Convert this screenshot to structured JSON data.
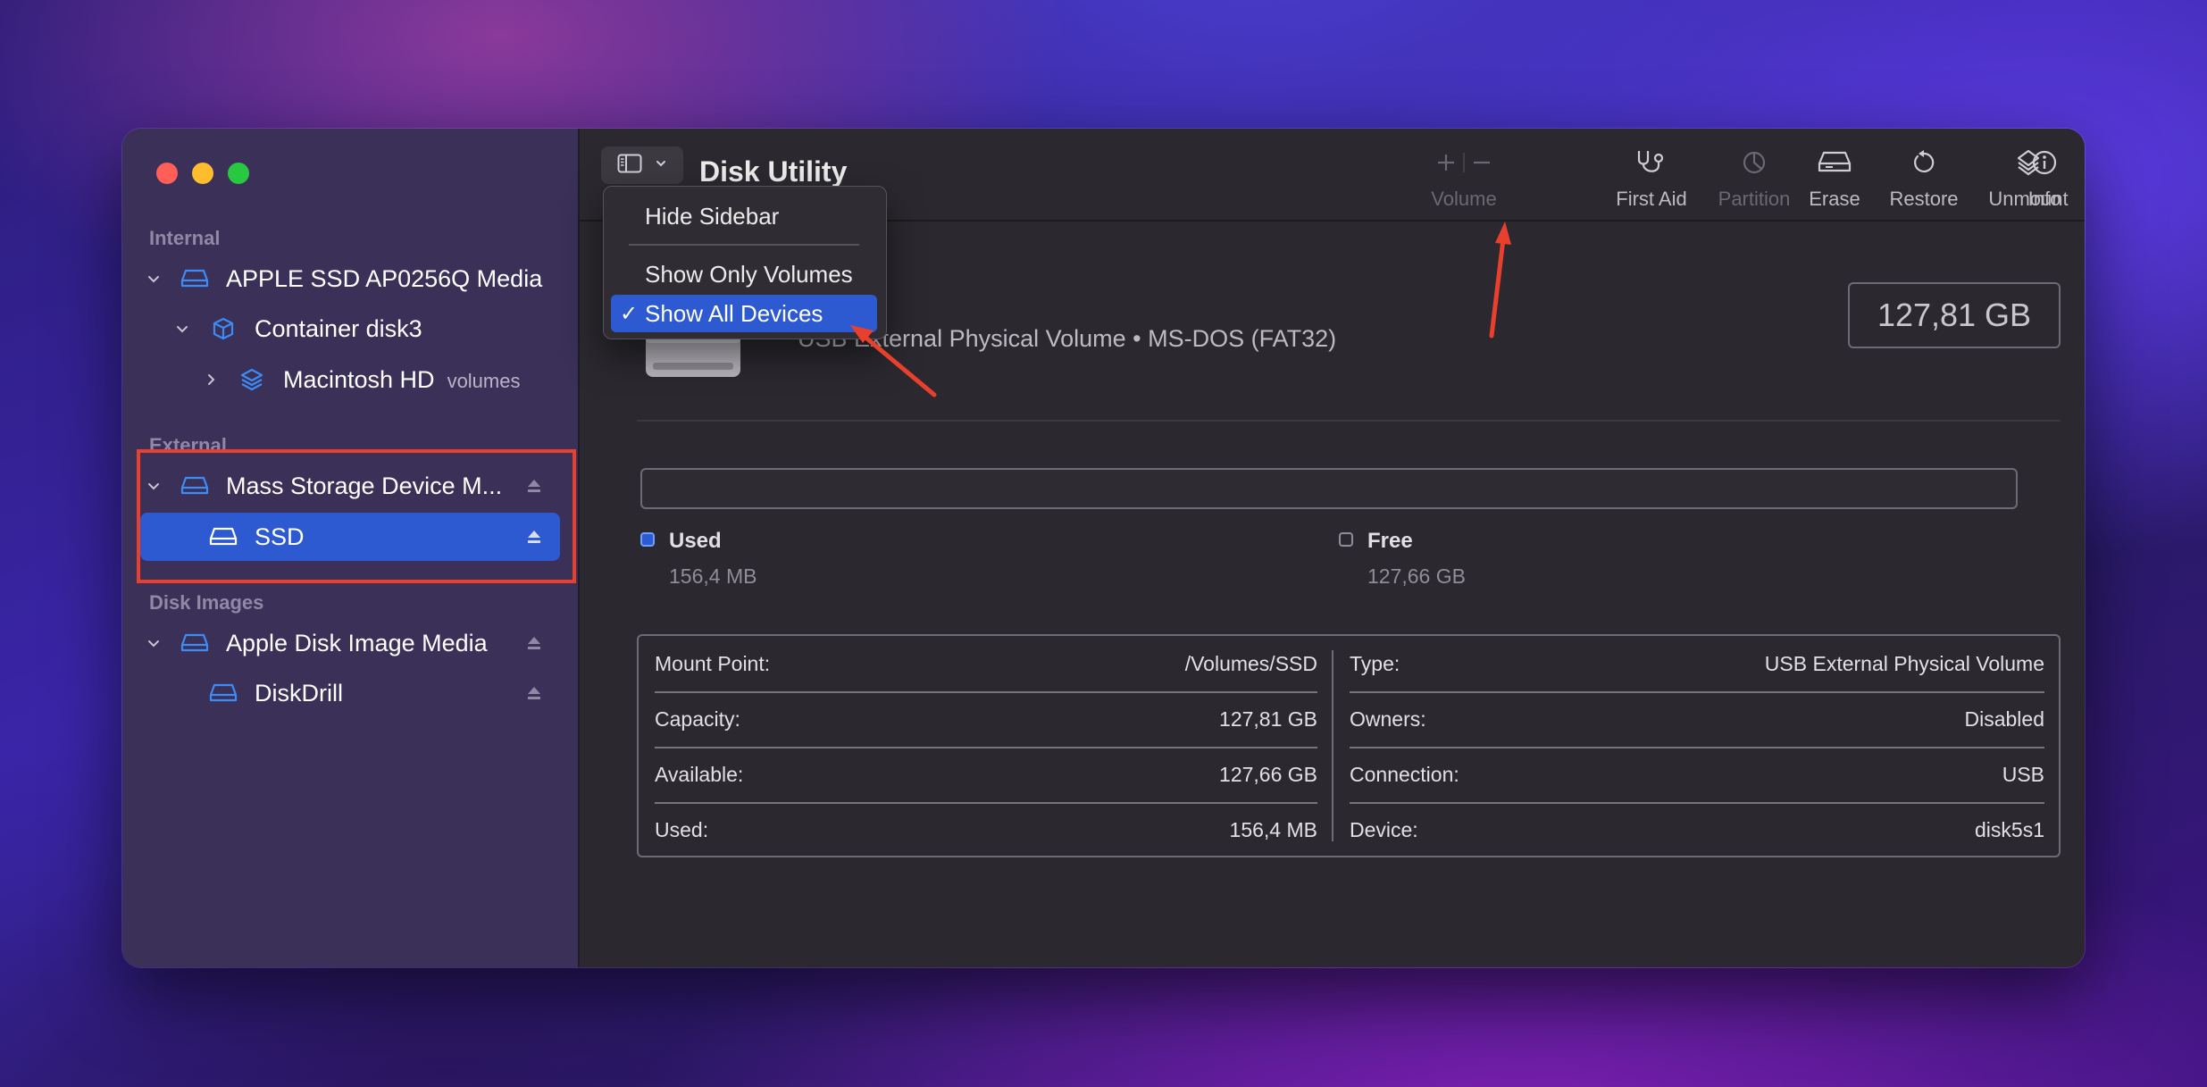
{
  "app": {
    "title": "Disk Utility"
  },
  "sidebar": {
    "sections": {
      "internal": "Internal",
      "external": "External",
      "disk_images": "Disk Images"
    },
    "items": [
      {
        "label": "APPLE SSD AP0256Q Media"
      },
      {
        "label": "Container disk3"
      },
      {
        "label": "Macintosh HD",
        "sub": "volumes"
      },
      {
        "label": "Mass Storage Device M..."
      },
      {
        "label": "SSD"
      },
      {
        "label": "Apple Disk Image Media"
      },
      {
        "label": "DiskDrill"
      }
    ]
  },
  "toolbar": {
    "volume": "Volume",
    "first_aid": "First Aid",
    "partition": "Partition",
    "erase": "Erase",
    "restore": "Restore",
    "unmount": "Unmount",
    "info": "Info"
  },
  "menu": {
    "hide_sidebar": "Hide Sidebar",
    "show_only_volumes": "Show Only Volumes",
    "show_all_devices": "Show All Devices",
    "checkmark": "✓"
  },
  "volume": {
    "subtitle": "USB External Physical Volume • MS-DOS (FAT32)",
    "capacity": "127,81 GB",
    "used_label": "Used",
    "used_value": "156,4 MB",
    "free_label": "Free",
    "free_value": "127,66 GB",
    "used_fraction": 0.0012
  },
  "info": {
    "left": [
      {
        "k": "Mount Point:",
        "v": "/Volumes/SSD"
      },
      {
        "k": "Capacity:",
        "v": "127,81 GB"
      },
      {
        "k": "Available:",
        "v": "127,66 GB"
      },
      {
        "k": "Used:",
        "v": "156,4 MB"
      }
    ],
    "right": [
      {
        "k": "Type:",
        "v": "USB External Physical Volume"
      },
      {
        "k": "Owners:",
        "v": "Disabled"
      },
      {
        "k": "Connection:",
        "v": "USB"
      },
      {
        "k": "Device:",
        "v": "disk5s1"
      }
    ]
  },
  "colors": {
    "accent": "#2d5ad1",
    "annotation": "#e8402d",
    "icon_blue": "#3d8bf5"
  }
}
